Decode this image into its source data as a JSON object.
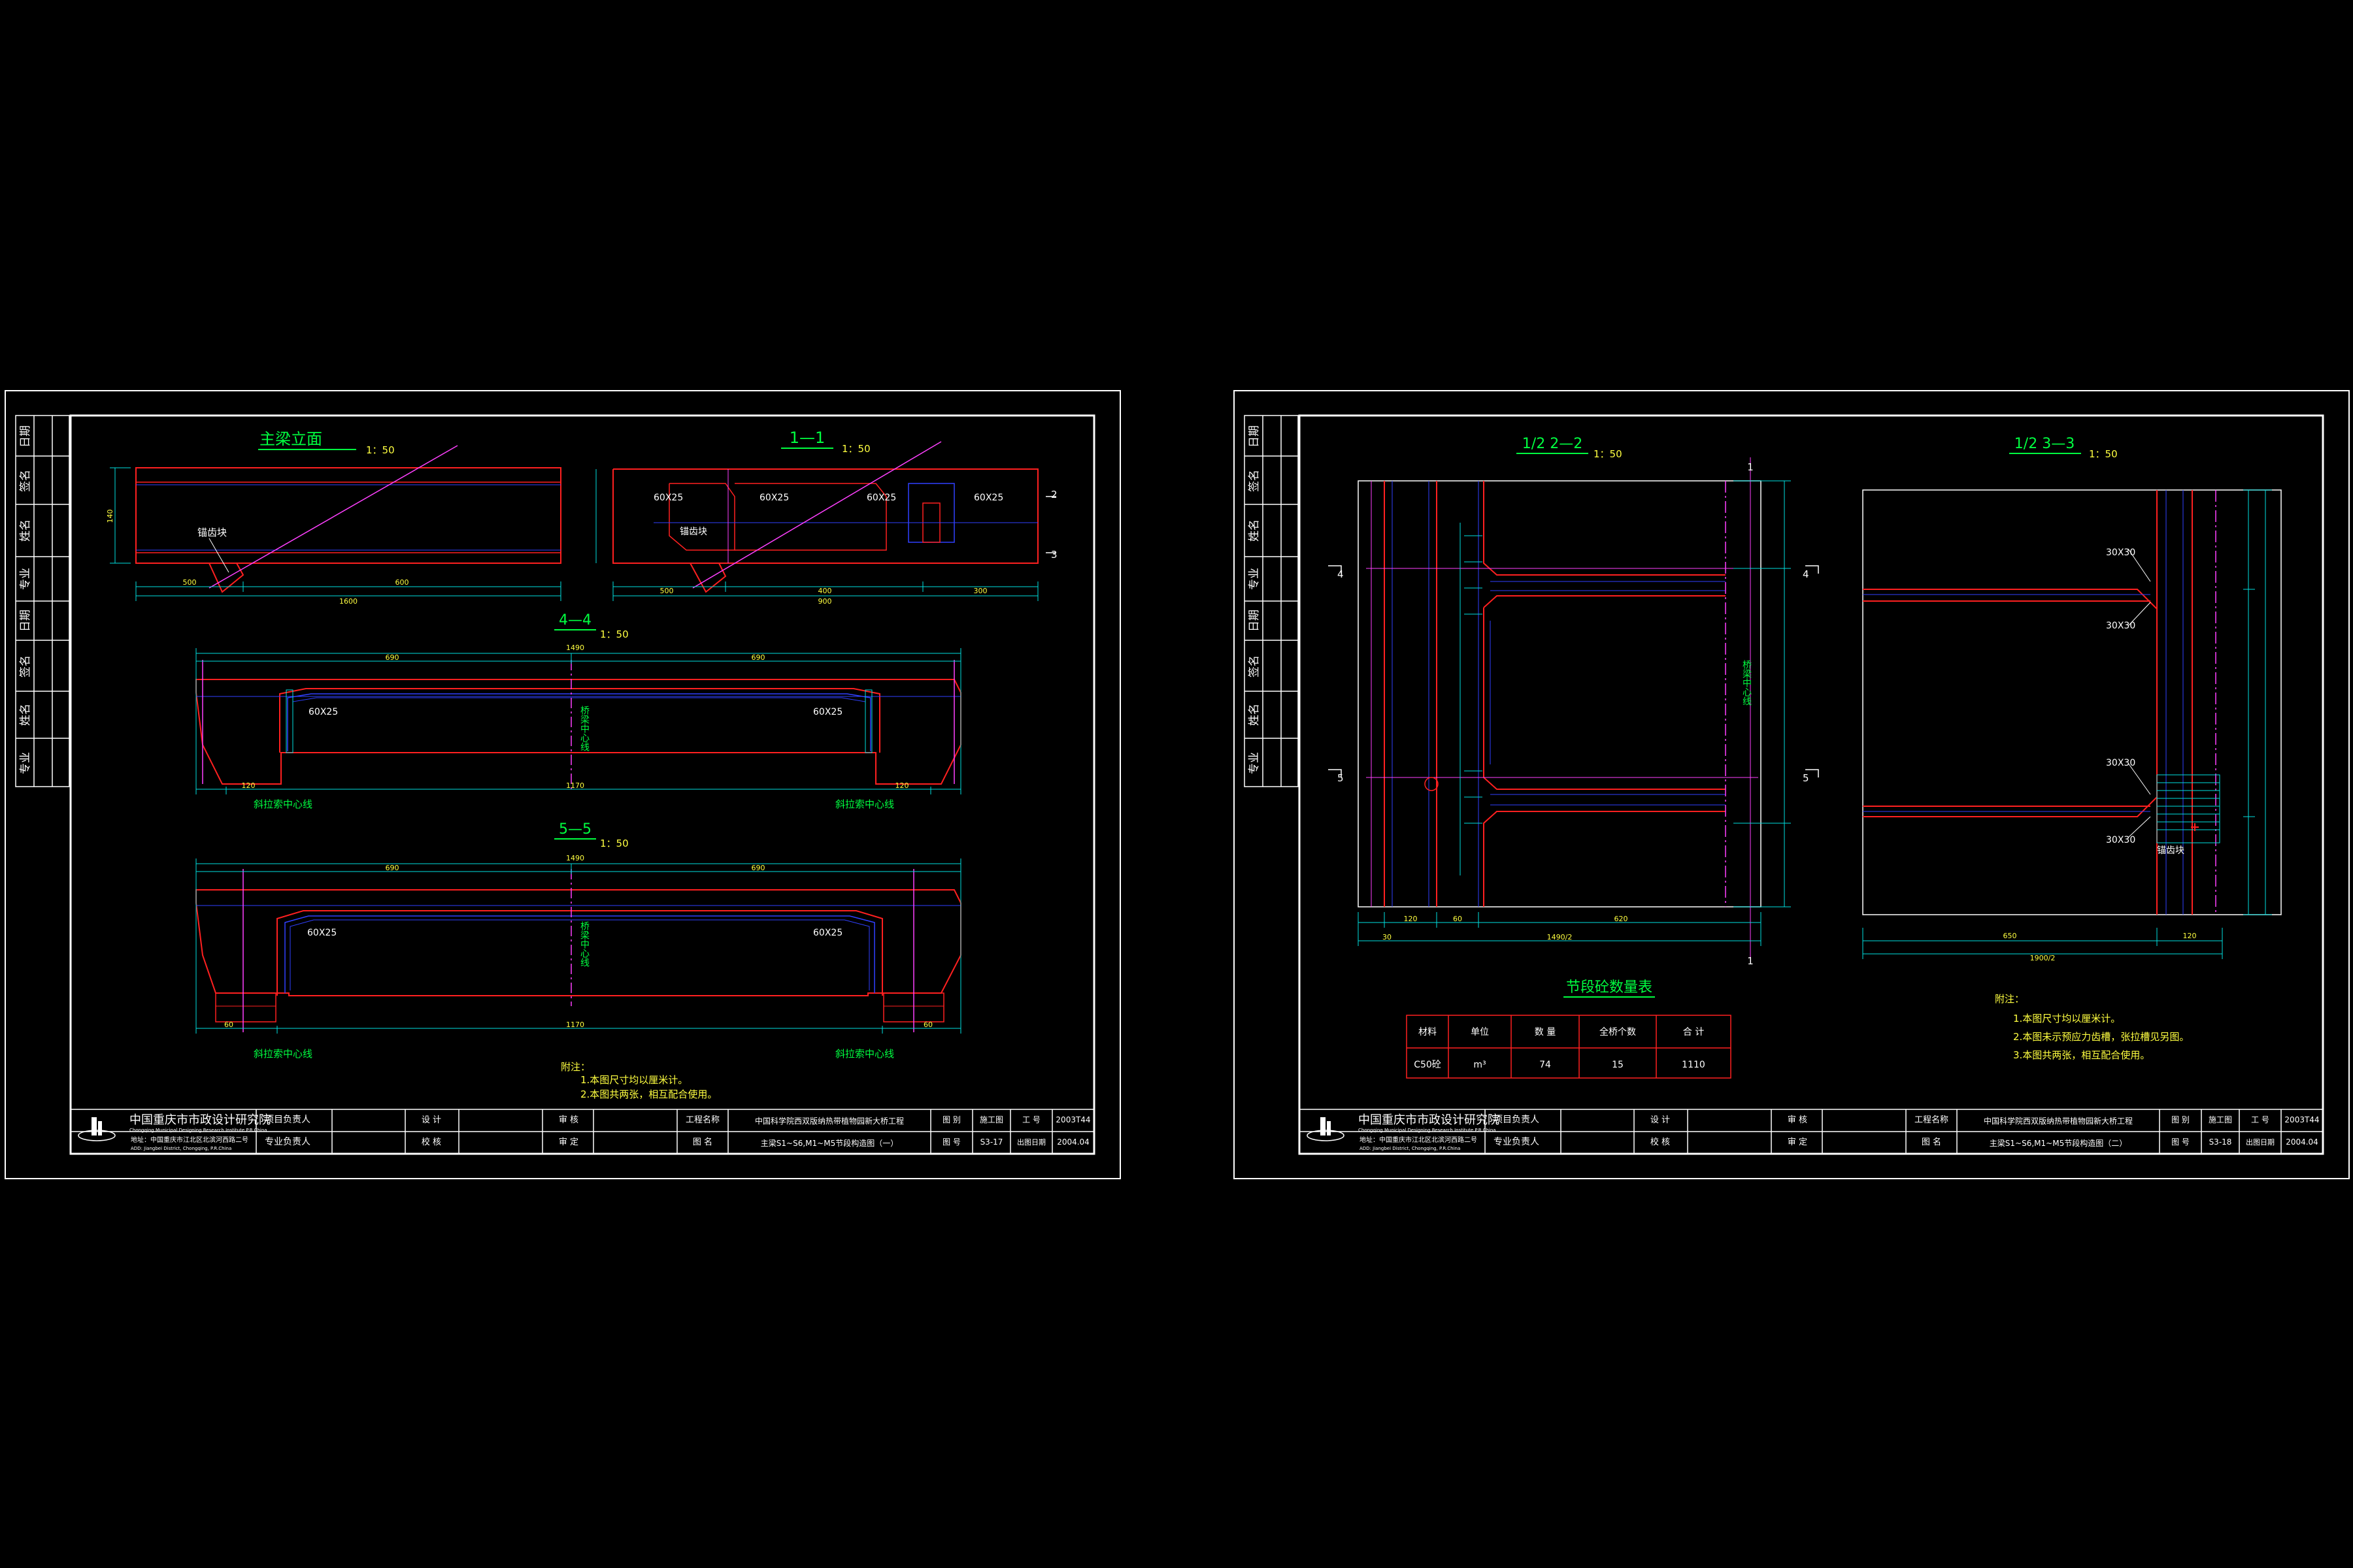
{
  "colors": {
    "background": "#000000",
    "frame": "#ffffff",
    "section": "#ff2020",
    "dimension": "#00e0e0",
    "rebar": "#3040ff",
    "centerline": "#ff40ff",
    "label": "#00ff40",
    "note": "#ffff40"
  },
  "sheet1": {
    "side_table": [
      "签",
      "日期",
      "签名",
      "姓名",
      "专业",
      "日期",
      "签名",
      "姓名",
      "专业"
    ],
    "views": {
      "elev_title": "主梁立面",
      "elev_scale": "1：50",
      "sec11_title": "1—1",
      "sec11_scale": "1：50",
      "sec44_title": "4—4",
      "sec44_scale": "1：50",
      "sec55_title": "5—5",
      "sec55_scale": "1：50"
    },
    "labels": {
      "anchor_block": "锚齿块",
      "anchor_block_2": "锚齿块",
      "haunch_a": "60X25",
      "haunch_b": "60X25",
      "haunch_c": "60X25",
      "haunch_d": "60X25",
      "haunch_44a": "60X25",
      "haunch_44b": "60X25",
      "haunch_55a": "60X25",
      "haunch_55b": "60X25",
      "cl_44": "桥梁中心线",
      "cl_55": "桥梁中心线",
      "cable_l_44": "斜拉索中心线",
      "cable_r_44": "斜拉索中心线",
      "cable_l_55": "斜拉索中心线",
      "cable_r_55": "斜拉索中心线",
      "sec_mark_2": "2",
      "sec_mark_3": "3",
      "sec_mark_2b": "2",
      "sec_mark_3b": "3"
    },
    "dims": {
      "e1": "500",
      "e2": "600",
      "e3": "1600",
      "e4": "140",
      "s1": "500",
      "s2": "400",
      "s3": "300",
      "s4": "900",
      "a1": "1490",
      "a2": "690",
      "a3": "690",
      "a4": "1170",
      "a5": "120",
      "a6": "120",
      "b1": "1490",
      "b2": "690",
      "b3": "690",
      "b4": "1170",
      "b5": "60",
      "b6": "60"
    },
    "notes": {
      "head": "附注：",
      "n1": "1.本图尺寸均以厘米计。",
      "n2": "2.本图共两张，相互配合使用。"
    },
    "titleblock": {
      "org": "中国重庆市市政设计研究院",
      "org_en": "Chongqing Municipal Designing Research Institute P.R.China",
      "address": "地址：中国重庆市江北区北滨河西路二号",
      "address_en": "ADD: Jiangbei District, Chongqing, P.R.China",
      "proj_lead": "项目负责人",
      "spec_lead": "专业负责人",
      "design": "设 计",
      "check": "校 核",
      "review": "审 核",
      "approve": "审 定",
      "project_label": "工程名称",
      "project_name": "中国科学院西双版纳热带植物园新大桥工程",
      "drawing_label": "图 名",
      "drawing_name": "主梁S1~S6,M1~M5节段构造图（一）",
      "stage_label": "图 别",
      "stage": "施工图",
      "job_label": "工 号",
      "job": "2003T44",
      "no_label": "图 号",
      "no": "S3-17",
      "date_label": "出图日期",
      "date": "2004.04"
    }
  },
  "sheet2": {
    "side_table": [
      "签",
      "日期",
      "签名",
      "姓名",
      "专业",
      "日期",
      "签名",
      "姓名",
      "专业"
    ],
    "views": {
      "sec22_title": "1/2  2—2",
      "sec22_scale": "1：50",
      "sec33_title": "1/2  3—3",
      "sec33_scale": "1：50"
    },
    "labels": {
      "cl": "桥梁中心线",
      "h1": "30X30",
      "h2": "30X30",
      "h3": "30X30",
      "h4": "30X30",
      "anchor": "锚齿块",
      "mark_1_top": "1",
      "mark_1_bot": "1",
      "mark_4_l": "4",
      "mark_4_r": "4",
      "mark_5_l": "5",
      "mark_5_r": "5"
    },
    "dims": {
      "d1": "120",
      "d2": "60",
      "d3": "620",
      "d4": "1490/2",
      "d5": "30",
      "g1": "650",
      "g2": "120",
      "g3": "1900/2"
    },
    "table": {
      "title": "节段砼数量表",
      "headers": [
        "材料",
        "单位",
        "数 量",
        "全桥个数",
        "合 计"
      ],
      "rows": [
        [
          "C50砼",
          "m³",
          "74",
          "15",
          "1110"
        ]
      ]
    },
    "notes": {
      "head": "附注：",
      "n1": "1.本图尺寸均以厘米计。",
      "n2": "2.本图未示预应力齿槽，张拉槽见另图。",
      "n3": "3.本图共两张，相互配合使用。"
    },
    "titleblock": {
      "org": "中国重庆市市政设计研究院",
      "org_en": "Chongqing Municipal Designing Research Institute P.R.China",
      "address": "地址：中国重庆市江北区北滨河西路二号",
      "address_en": "ADD: Jiangbei District, Chongqing, P.R.China",
      "proj_lead": "项目负责人",
      "spec_lead": "专业负责人",
      "design": "设 计",
      "check": "校 核",
      "review": "审 核",
      "approve": "审 定",
      "project_label": "工程名称",
      "project_name": "中国科学院西双版纳热带植物园新大桥工程",
      "drawing_label": "图 名",
      "drawing_name": "主梁S1~S6,M1~M5节段构造图（二）",
      "stage_label": "图 别",
      "stage": "施工图",
      "job_label": "工 号",
      "job": "2003T44",
      "no_label": "图 号",
      "no": "S3-18",
      "date_label": "出图日期",
      "date": "2004.04"
    }
  }
}
